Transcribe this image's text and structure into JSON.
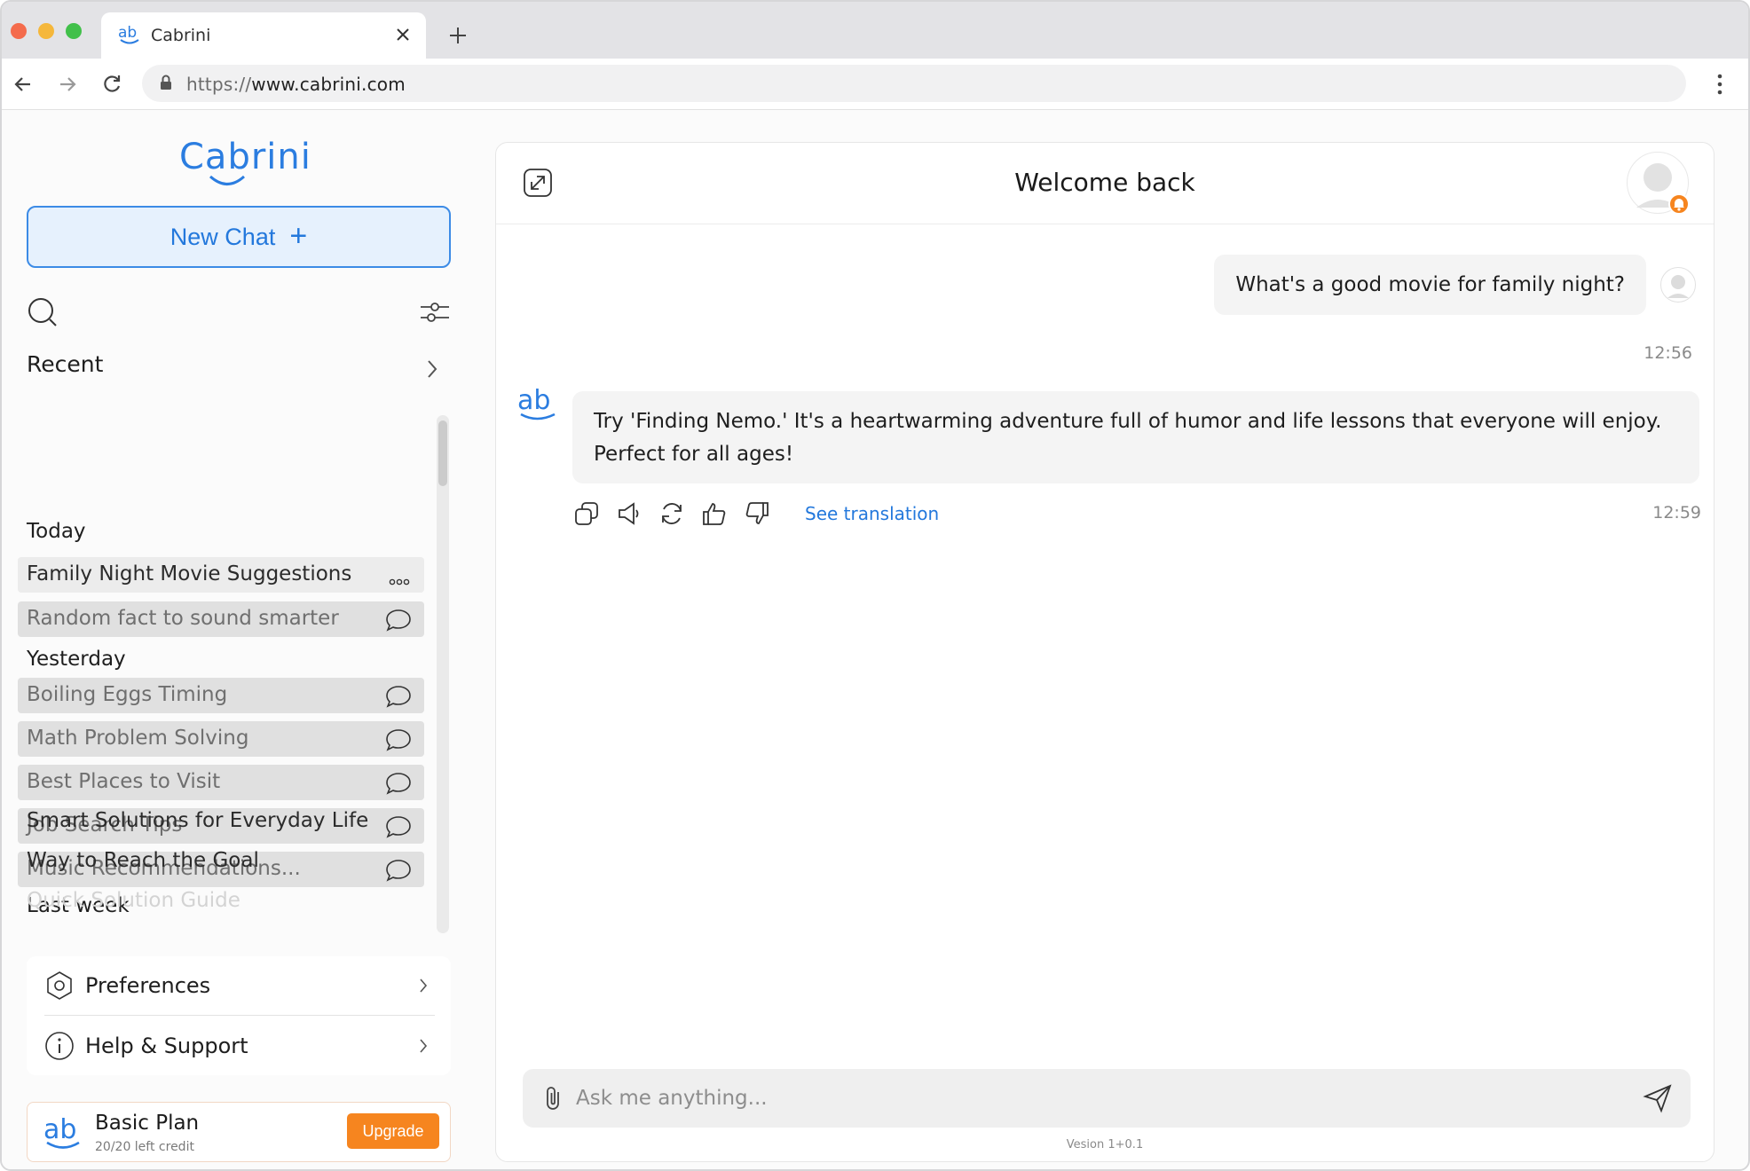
{
  "browser": {
    "tab_title": "Cabrini",
    "url_scheme": "https://",
    "url_host": "www.cabrini.com"
  },
  "sidebar": {
    "logo_text": "Cabrini",
    "new_chat_label": "New Chat",
    "recent_label": "Recent",
    "groups": {
      "today": "Today",
      "yesterday": "Yesterday",
      "last_week": "Last week"
    },
    "today_items": [
      "Family Night Movie Suggestions",
      "Random fact to sound smarter"
    ],
    "yesterday_items": [
      "Boiling Eggs Timing",
      "Math Problem Solving",
      "Best Places to Visit",
      "Job Search Tips",
      "Music Recommendations..."
    ],
    "last_week_items": [
      "Smart Solutions for Everyday Life",
      "Way to Reach the Goal",
      "Quick Solution Guide"
    ],
    "preferences_label": "Preferences",
    "help_label": "Help & Support",
    "plan_name": "Basic Plan",
    "plan_credit": "20/20 left credit",
    "upgrade_label": "Upgrade"
  },
  "chat": {
    "title": "Welcome back",
    "user_message": "What's a good movie for family night?",
    "user_time": "12:56",
    "bot_message": "Try 'Finding Nemo.' It's a heartwarming adventure full of humor and life lessons that everyone will enjoy. Perfect for all ages!",
    "bot_time": "12:59",
    "see_translation": "See translation",
    "input_placeholder": "Ask me anything...",
    "version": "Vesion 1+0.1"
  },
  "colors": {
    "accent_blue": "#2378dc",
    "accent_orange": "#f6851f"
  },
  "icons": [
    "search-icon",
    "filter-icon",
    "chevron-right-icon",
    "chat-bubble-icon",
    "more-dots-icon",
    "settings-icon",
    "info-icon",
    "expand-icon",
    "copy-icon",
    "speaker-icon",
    "refresh-icon",
    "thumbs-up-icon",
    "thumbs-down-icon",
    "paperclip-icon",
    "send-icon"
  ]
}
